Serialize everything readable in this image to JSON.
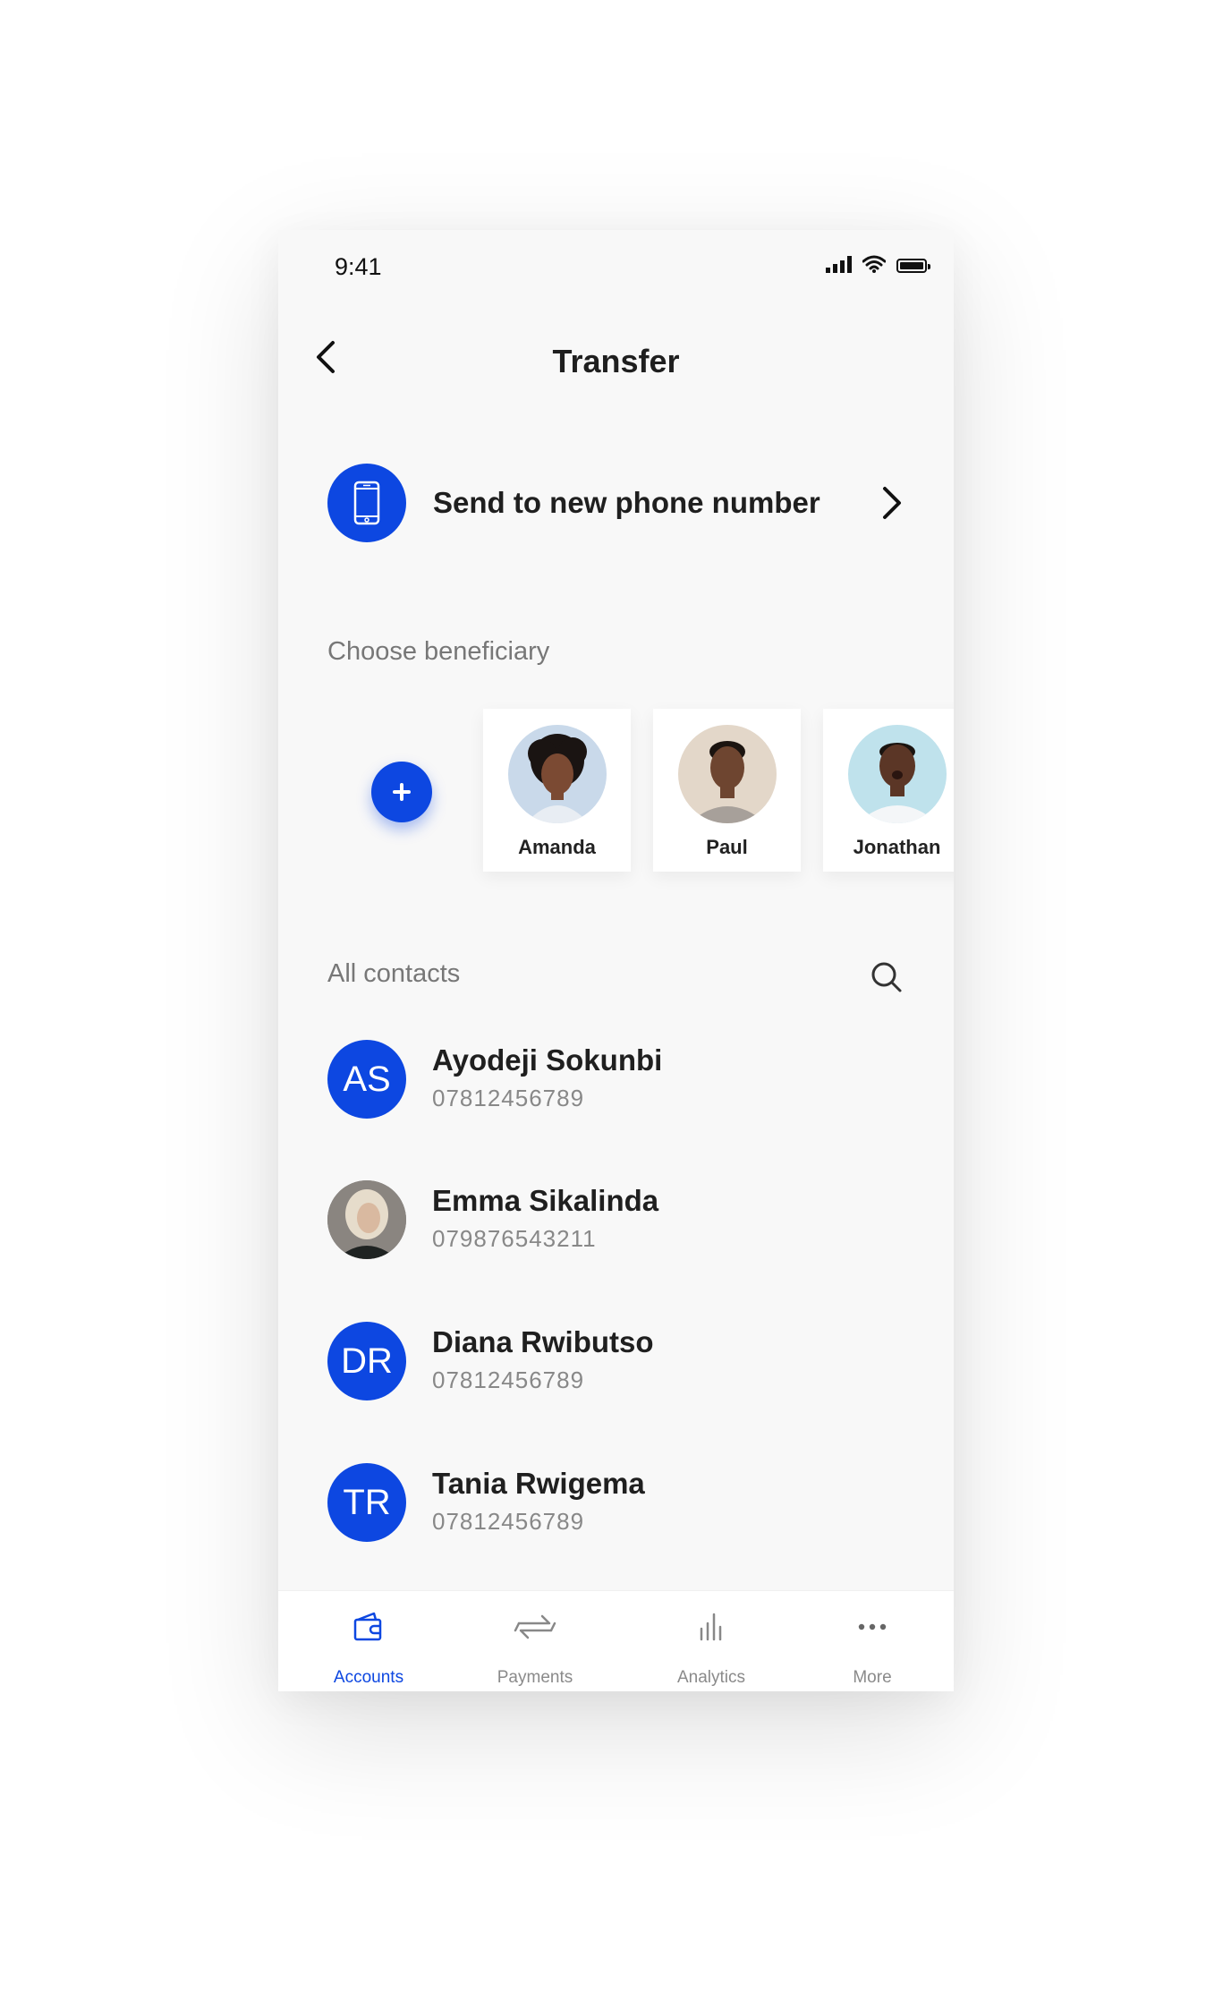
{
  "status_bar": {
    "time": "9:41"
  },
  "header": {
    "title": "Transfer"
  },
  "send_new": {
    "label": "Send to new phone number"
  },
  "beneficiary_section": {
    "label": "Choose beneficiary",
    "items": [
      {
        "name": "Amanda"
      },
      {
        "name": "Paul"
      },
      {
        "name": "Jonathan"
      }
    ]
  },
  "contacts_section": {
    "label": "All contacts",
    "contacts": [
      {
        "initials": "AS",
        "name": "Ayodeji Sokunbi",
        "phone": "07812456789",
        "has_photo": false
      },
      {
        "initials": "",
        "name": "Emma Sikalinda",
        "phone": "079876543211",
        "has_photo": true
      },
      {
        "initials": "DR",
        "name": "Diana Rwibutso",
        "phone": "07812456789",
        "has_photo": false
      },
      {
        "initials": "TR",
        "name": "Tania Rwigema",
        "phone": "07812456789",
        "has_photo": false
      }
    ]
  },
  "tab_bar": {
    "items": [
      {
        "label": "Accounts",
        "active": true,
        "icon": "wallet-icon"
      },
      {
        "label": "Payments",
        "active": false,
        "icon": "transfer-arrows-icon"
      },
      {
        "label": "Analytics",
        "active": false,
        "icon": "bar-chart-icon"
      },
      {
        "label": "More",
        "active": false,
        "icon": "more-dots-icon"
      }
    ]
  },
  "colors": {
    "accent": "#0d47e1",
    "background": "#f8f8f8"
  }
}
